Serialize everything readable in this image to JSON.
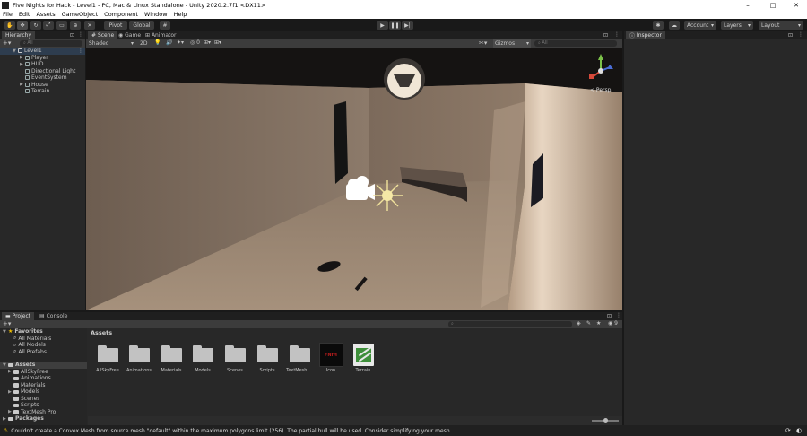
{
  "window": {
    "title": "Five Nights for Hack - Level1 - PC, Mac & Linux Standalone - Unity 2020.2.7f1 <DX11>",
    "minimize": "–",
    "maximize": "□",
    "close": "✕"
  },
  "menu": [
    "File",
    "Edit",
    "Assets",
    "GameObject",
    "Component",
    "Window",
    "Help"
  ],
  "toolbar": {
    "pivot": "Pivot",
    "global": "Global",
    "account": "Account",
    "layers": "Layers",
    "layout": "Layout"
  },
  "hierarchy": {
    "tab": "Hierarchy",
    "search_placeholder": "All",
    "scene": "Level1",
    "items": [
      "Player",
      "HUD",
      "Directional Light",
      "EventSystem",
      "House",
      "Terrain"
    ]
  },
  "scene_view": {
    "tabs": [
      "Scene",
      "Game",
      "Animator"
    ],
    "shading": "Shaded",
    "mode": "2D",
    "gizmos": "Gizmos",
    "search_placeholder": "All",
    "persp": "< Persp"
  },
  "inspector": {
    "tab": "Inspector"
  },
  "project": {
    "tabs": [
      "Project",
      "Console"
    ],
    "favorites_label": "Favorites",
    "favorites": [
      "All Materials",
      "All Models",
      "All Prefabs"
    ],
    "assets_label": "Assets",
    "asset_tree": [
      "AllSkyFree",
      "Animations",
      "Materials",
      "Models",
      "Scenes",
      "Scripts",
      "TextMesh Pro"
    ],
    "packages_label": "Packages",
    "breadcrumb": "Assets",
    "tiles": [
      "AllSkyFree",
      "Animations",
      "Materials",
      "Models",
      "Scenes",
      "Scripts",
      "TextMesh ...",
      "Icon",
      "Terrain"
    ],
    "icon_tile_text": "FNfH"
  },
  "status": {
    "message": "Couldn't create a Convex Mesh from source mesh \"default\" within the maximum polygons limit (256). The partial hull will be used. Consider simplifying your mesh."
  },
  "colors": {
    "panel": "#282828",
    "accent": "#3a79bb",
    "warning": "#f2c100"
  }
}
